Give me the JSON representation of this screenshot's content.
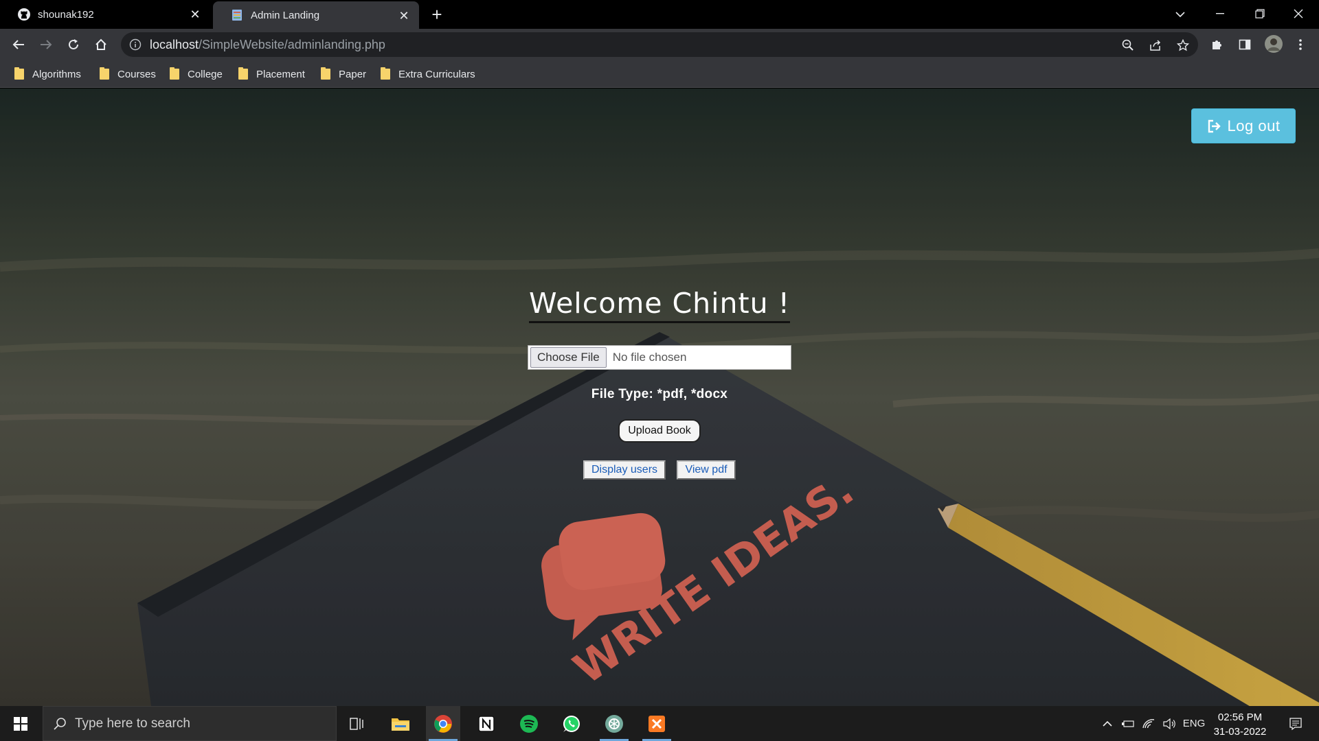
{
  "browser": {
    "tabs": [
      {
        "title": "shounak192",
        "icon": "github-icon",
        "active": false
      },
      {
        "title": "Admin Landing",
        "icon": "page-icon",
        "active": true
      }
    ],
    "url_host": "localhost",
    "url_path": "/SimpleWebsite/adminlanding.php",
    "bookmarks": [
      "Algorithms",
      "Courses",
      "College",
      "Placement",
      "Paper",
      "Extra Curriculars"
    ]
  },
  "page": {
    "logout_label": "Log out",
    "welcome": "Welcome Chintu !",
    "file_input": {
      "button": "Choose File",
      "status": "No file chosen"
    },
    "file_type": "File Type: *pdf, *docx",
    "upload_label": "Upload Book",
    "display_users_label": "Display users",
    "view_pdf_label": "View pdf",
    "background_text": "WRITE IDEAS."
  },
  "taskbar": {
    "search_placeholder": "Type here to search",
    "apps": [
      "task-view-icon",
      "file-explorer-icon",
      "chrome-icon",
      "notion-icon",
      "spotify-icon",
      "whatsapp-icon",
      "chatgpt-icon",
      "xampp-icon"
    ],
    "language": "ENG",
    "time": "02:56 PM",
    "date": "31-03-2022"
  },
  "colors": {
    "accent_button": "#5bc0de",
    "bookmark_folder": "#f7d36b",
    "link": "#1a5cb8"
  }
}
